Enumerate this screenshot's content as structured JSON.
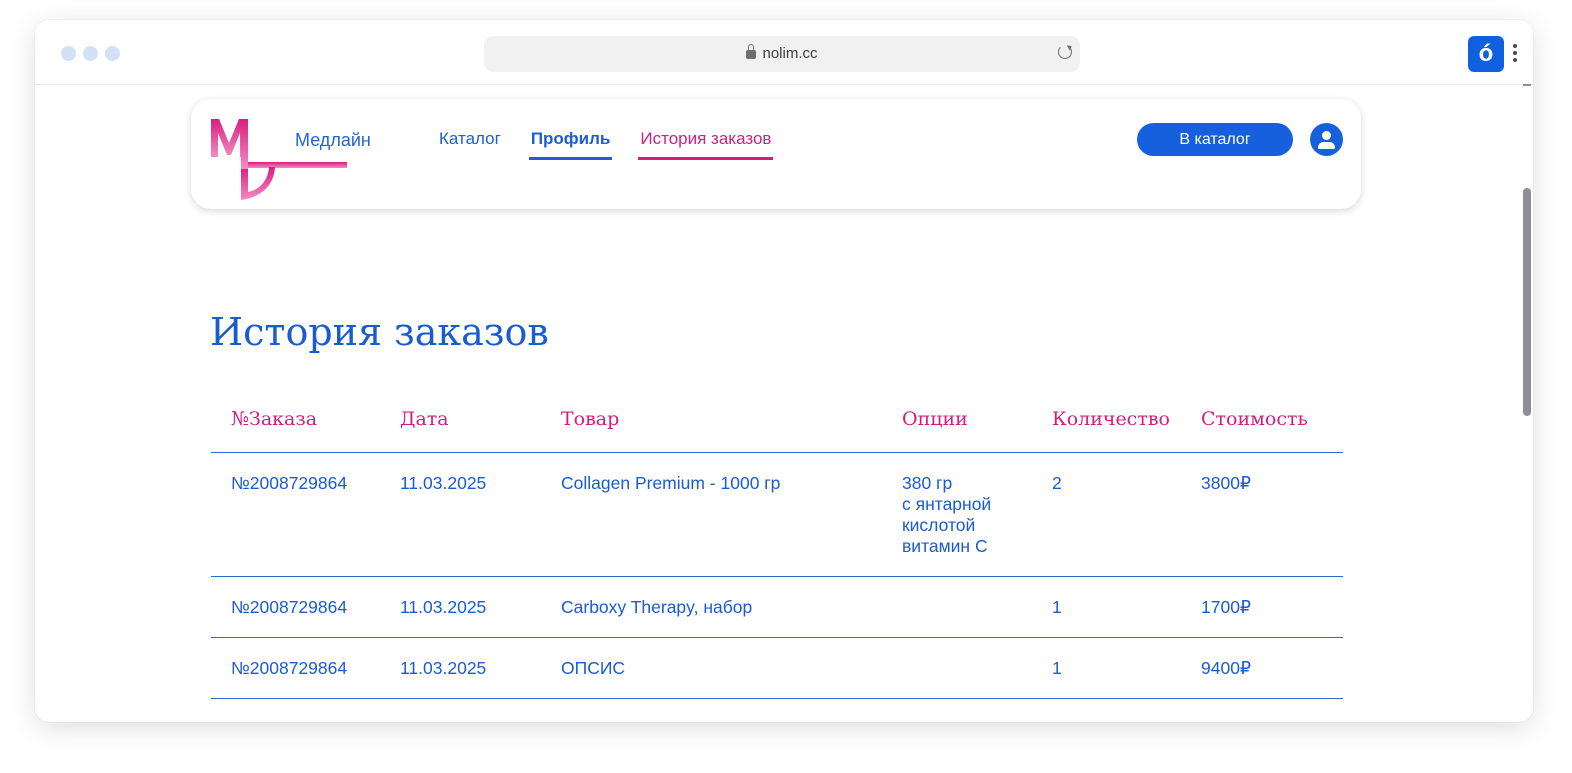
{
  "browser": {
    "url": "nolim.cc",
    "extension_glyph": "ó"
  },
  "header": {
    "logo_text": "Медлайн",
    "nav": {
      "catalog": "Каталог",
      "profile": "Профиль",
      "history": "История заказов"
    },
    "catalog_button": "В каталог"
  },
  "page": {
    "title": "История заказов"
  },
  "orders": {
    "columns": [
      "№Заказа",
      "Дата",
      "Товар",
      "Опции",
      "Количество",
      "Стоимость"
    ],
    "rows": [
      {
        "number": "№2008729864",
        "date": "11.03.2025",
        "product": "Collagen Premium - 1000 гр",
        "options": [
          "380 гр",
          "с янтарной",
          "кислотой",
          "витамин С"
        ],
        "quantity": "2",
        "price": "3800₽"
      },
      {
        "number": "№2008729864",
        "date": "11.03.2025",
        "product": "Carboxy Therapy, набор",
        "options": [],
        "quantity": "1",
        "price": "1700₽"
      },
      {
        "number": "№2008729864",
        "date": "11.03.2025",
        "product": "ОПСИС",
        "options": [],
        "quantity": "1",
        "price": "9400₽"
      }
    ]
  },
  "colors": {
    "primary_blue": "#1b5bd0",
    "accent_pink": "#d11f7e"
  }
}
